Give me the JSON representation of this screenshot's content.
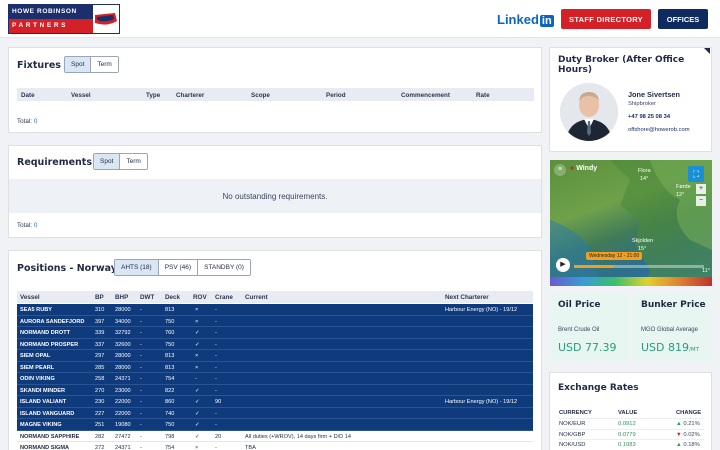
{
  "header": {
    "logo_top": "HOWE ROBINSON",
    "logo_bottom": "PARTNERS",
    "linkedin": "Linked",
    "linkedin_in": "in",
    "staff_directory": "STAFF DIRECTORY",
    "offices": "OFFICES"
  },
  "fixtures": {
    "title": "Fixtures",
    "tabs": [
      "Spot",
      "Term"
    ],
    "active_tab": "Spot",
    "columns": [
      "Date",
      "Vessel",
      "Type",
      "Charterer",
      "Scope",
      "Period",
      "Commencement",
      "Rate"
    ],
    "total_label": "Total:",
    "total_value": "0"
  },
  "requirements": {
    "title": "Requirements",
    "tabs": [
      "Spot",
      "Term"
    ],
    "active_tab": "Spot",
    "empty_message": "No outstanding requirements.",
    "total_label": "Total:",
    "total_value": "0"
  },
  "positions": {
    "title": "Positions - Norway",
    "tabs": [
      "AHTS (18)",
      "PSV (46)",
      "STANDBY (0)"
    ],
    "active_tab": "AHTS (18)",
    "columns": [
      "Vessel",
      "BP",
      "BHP",
      "DWT",
      "Deck",
      "ROV",
      "Crane",
      "Current",
      "Next Charterer"
    ],
    "rows": [
      {
        "vessel": "SEA5 RUBY",
        "bp": "310",
        "bhp": "28000",
        "dwt": "-",
        "deck": "813",
        "rov": "×",
        "crane": "-",
        "current": "",
        "next": "Harbour Energy (NO) - 19/12",
        "highlight": true
      },
      {
        "vessel": "AURORA SANDEFJORD",
        "bp": "397",
        "bhp": "34000",
        "dwt": "-",
        "deck": "750",
        "rov": "×",
        "crane": "-",
        "current": "",
        "next": "",
        "highlight": true
      },
      {
        "vessel": "NORMAND DROTT",
        "bp": "339",
        "bhp": "32792",
        "dwt": "-",
        "deck": "760",
        "rov": "✓",
        "crane": "-",
        "current": "",
        "next": "",
        "highlight": true
      },
      {
        "vessel": "NORMAND PROSPER",
        "bp": "337",
        "bhp": "32600",
        "dwt": "-",
        "deck": "750",
        "rov": "✓",
        "crane": "-",
        "current": "",
        "next": "",
        "highlight": true
      },
      {
        "vessel": "SIEM OPAL",
        "bp": "297",
        "bhp": "28000",
        "dwt": "-",
        "deck": "813",
        "rov": "×",
        "crane": "-",
        "current": "",
        "next": "",
        "highlight": true
      },
      {
        "vessel": "SIEM PEARL",
        "bp": "285",
        "bhp": "28000",
        "dwt": "-",
        "deck": "813",
        "rov": "×",
        "crane": "-",
        "current": "",
        "next": "",
        "highlight": true
      },
      {
        "vessel": "ODIN VIKING",
        "bp": "258",
        "bhp": "24371",
        "dwt": "-",
        "deck": "754",
        "rov": "-",
        "crane": "-",
        "current": "",
        "next": "",
        "highlight": true
      },
      {
        "vessel": "SKANDI MINDER",
        "bp": "270",
        "bhp": "23000",
        "dwt": "-",
        "deck": "822",
        "rov": "✓",
        "crane": "-",
        "current": "",
        "next": "",
        "highlight": true
      },
      {
        "vessel": "ISLAND VALIANT",
        "bp": "230",
        "bhp": "22000",
        "dwt": "-",
        "deck": "860",
        "rov": "✓",
        "crane": "90",
        "current": "",
        "next": "Harbour Energy (NO) - 19/12",
        "highlight": true
      },
      {
        "vessel": "ISLAND VANGUARD",
        "bp": "227",
        "bhp": "22000",
        "dwt": "-",
        "deck": "740",
        "rov": "✓",
        "crane": "-",
        "current": "",
        "next": "",
        "highlight": true
      },
      {
        "vessel": "MAGNE VIKING",
        "bp": "251",
        "bhp": "19080",
        "dwt": "-",
        "deck": "750",
        "rov": "✓",
        "crane": "-",
        "current": "",
        "next": "",
        "highlight": true
      },
      {
        "vessel": "NORMAND SAPPHIRE",
        "bp": "282",
        "bhp": "27472",
        "dwt": "-",
        "deck": "798",
        "rov": "✓",
        "crane": "20",
        "current": "All duties (+WROV), 14 days firm + D/D 14",
        "next": "",
        "highlight": false
      },
      {
        "vessel": "NORMAND SIGMA",
        "bp": "272",
        "bhp": "24371",
        "dwt": "-",
        "deck": "754",
        "rov": "×",
        "crane": "-",
        "current": "TBA",
        "next": "",
        "highlight": false
      }
    ]
  },
  "broker": {
    "title": "Duty Broker (After Office Hours)",
    "name": "Jone Sivertsen",
    "role": "Shipbroker",
    "phone": "+47 98 25 08 34",
    "email": "offshore@howerob.com"
  },
  "map": {
    "brand": "Windy",
    "date": "Wednesday 12 - 21:00",
    "labels": [
      "Flora",
      "14°",
      "Førde",
      "12°",
      "Skjolden",
      "15°",
      "11°"
    ]
  },
  "oil": {
    "title": "Oil Price",
    "label": "Brent Crude Oil",
    "value": "USD 77.39"
  },
  "bunker": {
    "title": "Bunker Price",
    "label": "MGO Global Average",
    "value": "USD 819",
    "unit": "/MT"
  },
  "fx": {
    "title": "Exchange Rates",
    "columns": [
      "CURRENCY",
      "VALUE",
      "CHANGE"
    ],
    "rows": [
      {
        "pair": "NOK/EUR",
        "value": "0.0912",
        "change": "0.21%",
        "dir": "up"
      },
      {
        "pair": "NOK/GBP",
        "value": "0.0779",
        "change": "0.02%",
        "dir": "down"
      },
      {
        "pair": "NOK/USD",
        "value": "0.1083",
        "change": "0.18%",
        "dir": "up"
      }
    ]
  },
  "colors": {
    "brand_navy": "#1a2f6b",
    "brand_red": "#d42027",
    "row_highlight": "#0f3a7c",
    "price_green": "#2a9a7a"
  }
}
